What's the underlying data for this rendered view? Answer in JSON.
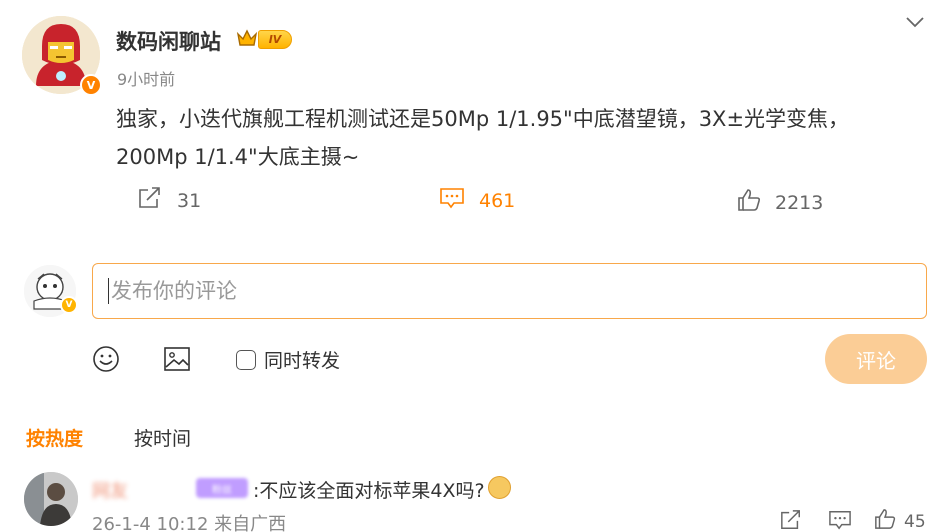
{
  "post": {
    "author_name": "数码闲聊站",
    "level_badge": "IV",
    "verified_mark": "V",
    "time": "9小时前",
    "text": "独家，小迭代旗舰工程机测试还是50Mp 1/1.95\"中底潜望镜，3X±光学变焦，200Mp 1/1.4\"大底主摄~",
    "actions": {
      "repost_count": "31",
      "comment_count": "461",
      "like_count": "2213"
    }
  },
  "composer": {
    "placeholder": "发布你的评论",
    "sync_label": "同时转发",
    "submit_label": "评论",
    "verified_mark": "V"
  },
  "sort_tabs": {
    "hot": "按热度",
    "time": "按时间"
  },
  "comments": [
    {
      "name": "网友",
      "badge": "粉丝",
      "text": ":不应该全面对标苹果4X吗?",
      "meta": "26-1-4 10:12 来自广西",
      "like_count": "45"
    }
  ],
  "colors": {
    "accent": "#ff8200",
    "submit_disabled": "#fbcd96",
    "input_border": "#f8a84b"
  },
  "icons": [
    "more-chevron-icon",
    "crown-icon",
    "repost-icon",
    "comment-icon",
    "like-icon",
    "emoji-icon",
    "image-icon"
  ]
}
